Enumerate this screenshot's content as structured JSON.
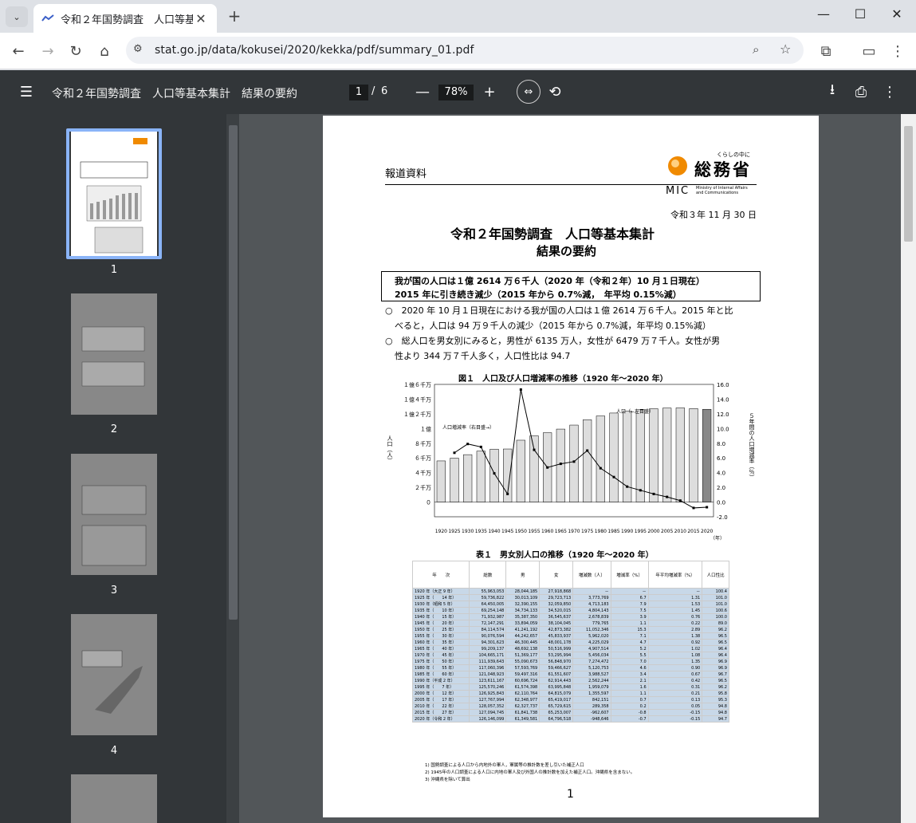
{
  "browser": {
    "tab_title": "令和２年国勢調査　人口等基本",
    "url": "stat.go.jp/data/kokusei/2020/kekka/pdf/summary_01.pdf"
  },
  "pdf_toolbar": {
    "title": "令和２年国勢調査　人口等基本集計　結果の要約",
    "page_current": "1",
    "page_sep": "/",
    "page_total": "6",
    "zoom": "78%"
  },
  "thumbnails": [
    "1",
    "2",
    "3",
    "4"
  ],
  "document": {
    "header_left": "報道資料",
    "logo_tagline": "くらしの中に",
    "logo_name": "総務省",
    "logo_mic": "MIC",
    "logo_en1": "Ministry of Internal Affairs",
    "logo_en2": "and Communications",
    "date": "令和３年 11 月 30 日",
    "title1": "令和２年国勢調査　人口等基本集計",
    "title2": "結果の要約",
    "box_line1": "我が国の人口は１億 2614 万６千人（2020 年（令和２年）10 月１日現在）",
    "box_line2": "2015 年に引き続き減少（2015 年から 0.7%減，　年平均 0.15%減）",
    "bullet1_l1": "○　2020 年 10 月１日現在における我が国の人口は１億 2614 万６千人。2015 年と比",
    "bullet1_l2": "べると，人口は 94 万９千人の減少（2015 年から 0.7%減，年平均 0.15%減）",
    "bullet2_l1": "○　総人口を男女別にみると，男性が 6135 万人，女性が 6479 万７千人。女性が男",
    "bullet2_l2": "性より 344 万７千人多く，人口性比は 94.7",
    "fig_title": "図１　人口及び人口増減率の推移（1920 年～2020 年）",
    "table_title": "表１　男女別人口の推移（1920 年～2020 年）",
    "page_number": "1",
    "footnote1": "1) 国勢調査による人口から内地外の軍人，軍属等の推計数を差し引いた補正人口",
    "footnote2": "2) 1945年の人口調査による人口に内地の軍人及び外国人の推計数を加えた補正人口。沖縄県を含まない。",
    "footnote3": "3) 沖縄県を除いて算出"
  },
  "chart_data": {
    "type": "bar",
    "title": "図１　人口及び人口増減率の推移（1920 年～2020 年）",
    "ylabel": "人口（人）",
    "y2label": "５年間の人口増減率（％）",
    "categories": [
      "1920",
      "1925",
      "1930",
      "1935",
      "1940",
      "1945",
      "1950",
      "1955",
      "1960",
      "1965",
      "1970",
      "1975",
      "1980",
      "1985",
      "1990",
      "1995",
      "2000",
      "2005",
      "2010",
      "2015",
      "2020"
    ],
    "y_tick_labels": [
      "１億６千万",
      "１億４千万",
      "１億２千万",
      "１億",
      "８千万",
      "６千万",
      "４千万",
      "２千万",
      "０"
    ],
    "y2_tick_labels": [
      "16.0",
      "14.0",
      "12.0",
      "10.0",
      "8.0",
      "6.0",
      "4.0",
      "2.0",
      "0.0",
      "-2.0"
    ],
    "ylim": [
      0,
      160000000
    ],
    "y2lim": [
      -2,
      16
    ],
    "x_suffix": "（年）",
    "annotations": [
      "人口増減率（右目盛→）",
      "人口（←左目盛）"
    ],
    "series": [
      {
        "name": "人口",
        "values": [
          55963053,
          59736822,
          64450005,
          69254148,
          71933000,
          72147291,
          84114574,
          90076594,
          94301623,
          99209137,
          104665171,
          111939643,
          117060396,
          121048923,
          123611167,
          125570246,
          126925843,
          127767994,
          128057352,
          127094745,
          126146099
        ]
      },
      {
        "name": "人口増減率",
        "values": [
          null,
          6.7,
          7.9,
          7.5,
          3.9,
          1.1,
          15.3,
          7.1,
          4.7,
          5.2,
          5.5,
          7.0,
          4.6,
          3.4,
          2.1,
          1.6,
          1.1,
          0.7,
          0.2,
          -0.8,
          -0.7
        ]
      }
    ]
  },
  "table1": {
    "headers": [
      "年　　次",
      "総数",
      "男",
      "女",
      "増減数（人）",
      "増減率（%）",
      "年平均増減率（%）",
      "人口性比"
    ],
    "rows": [
      [
        "1920 年（大正 9 年）",
        "55,963,053",
        "28,044,185",
        "27,918,868",
        "－",
        "－",
        "－",
        "100.4"
      ],
      [
        "1925 年（　　14 年）",
        "59,736,822",
        "30,013,109",
        "29,723,713",
        "3,773,769",
        "6.7",
        "1.31",
        "101.0"
      ],
      [
        "1930 年（昭和 5 年）",
        "64,450,005",
        "32,390,155",
        "32,059,850",
        "4,713,183",
        "7.9",
        "1.53",
        "101.0"
      ],
      [
        "1935 年（　　10 年）",
        "69,254,148",
        "34,734,133",
        "34,520,015",
        "4,804,143",
        "7.5",
        "1.45",
        "100.6"
      ],
      [
        "1940 年（　　15 年）",
        "71,932,987",
        "35,387,350",
        "36,545,637",
        "2,678,839",
        "3.9",
        "0.76",
        "100.0"
      ],
      [
        "1945 年（　　20 年）",
        "72,147,291",
        "33,894,059",
        "38,104,045",
        "779,765",
        "1.1",
        "0.22",
        "89.0"
      ],
      [
        "1950 年（　　25 年）",
        "84,114,574",
        "41,241,192",
        "42,873,382",
        "11,052,346",
        "15.3",
        "2.89",
        "96.2"
      ],
      [
        "1955 年（　　30 年）",
        "90,076,594",
        "44,242,657",
        "45,833,937",
        "5,962,020",
        "7.1",
        "1.38",
        "96.5"
      ],
      [
        "1960 年（　　35 年）",
        "94,301,623",
        "46,300,445",
        "48,001,178",
        "4,225,029",
        "4.7",
        "0.92",
        "96.5"
      ],
      [
        "1965 年（　　40 年）",
        "99,209,137",
        "48,692,138",
        "50,516,999",
        "4,907,514",
        "5.2",
        "1.02",
        "96.4"
      ],
      [
        "1970 年（　　45 年）",
        "104,665,171",
        "51,369,177",
        "53,295,994",
        "5,456,034",
        "5.5",
        "1.08",
        "96.4"
      ],
      [
        "1975 年（　　50 年）",
        "111,939,643",
        "55,090,673",
        "56,848,970",
        "7,274,472",
        "7.0",
        "1.35",
        "96.9"
      ],
      [
        "1980 年（　　55 年）",
        "117,060,396",
        "57,593,769",
        "59,466,627",
        "5,120,753",
        "4.6",
        "0.90",
        "96.9"
      ],
      [
        "1985 年（　　60 年）",
        "121,048,923",
        "59,497,316",
        "61,551,607",
        "3,988,527",
        "3.4",
        "0.67",
        "96.7"
      ],
      [
        "1990 年（平成 2 年）",
        "123,611,167",
        "60,696,724",
        "62,914,443",
        "2,562,244",
        "2.1",
        "0.42",
        "96.5"
      ],
      [
        "1995 年（　　7 年）",
        "125,570,246",
        "61,574,398",
        "63,995,848",
        "1,959,079",
        "1.6",
        "0.31",
        "96.2"
      ],
      [
        "2000 年（　　12 年）",
        "126,925,843",
        "62,110,764",
        "64,815,079",
        "1,355,597",
        "1.1",
        "0.21",
        "95.8"
      ],
      [
        "2005 年（　　17 年）",
        "127,767,994",
        "62,348,977",
        "65,419,017",
        "842,151",
        "0.7",
        "0.13",
        "95.3"
      ],
      [
        "2010 年（　　22 年）",
        "128,057,352",
        "62,327,737",
        "65,729,615",
        "289,358",
        "0.2",
        "0.05",
        "94.8"
      ],
      [
        "2015 年（　　27 年）",
        "127,094,745",
        "61,841,738",
        "65,253,007",
        "-962,607",
        "-0.8",
        "-0.15",
        "94.8"
      ],
      [
        "2020 年（令和 2 年）",
        "126,146,099",
        "61,349,581",
        "64,796,518",
        "-948,646",
        "-0.7",
        "-0.15",
        "94.7"
      ]
    ]
  }
}
